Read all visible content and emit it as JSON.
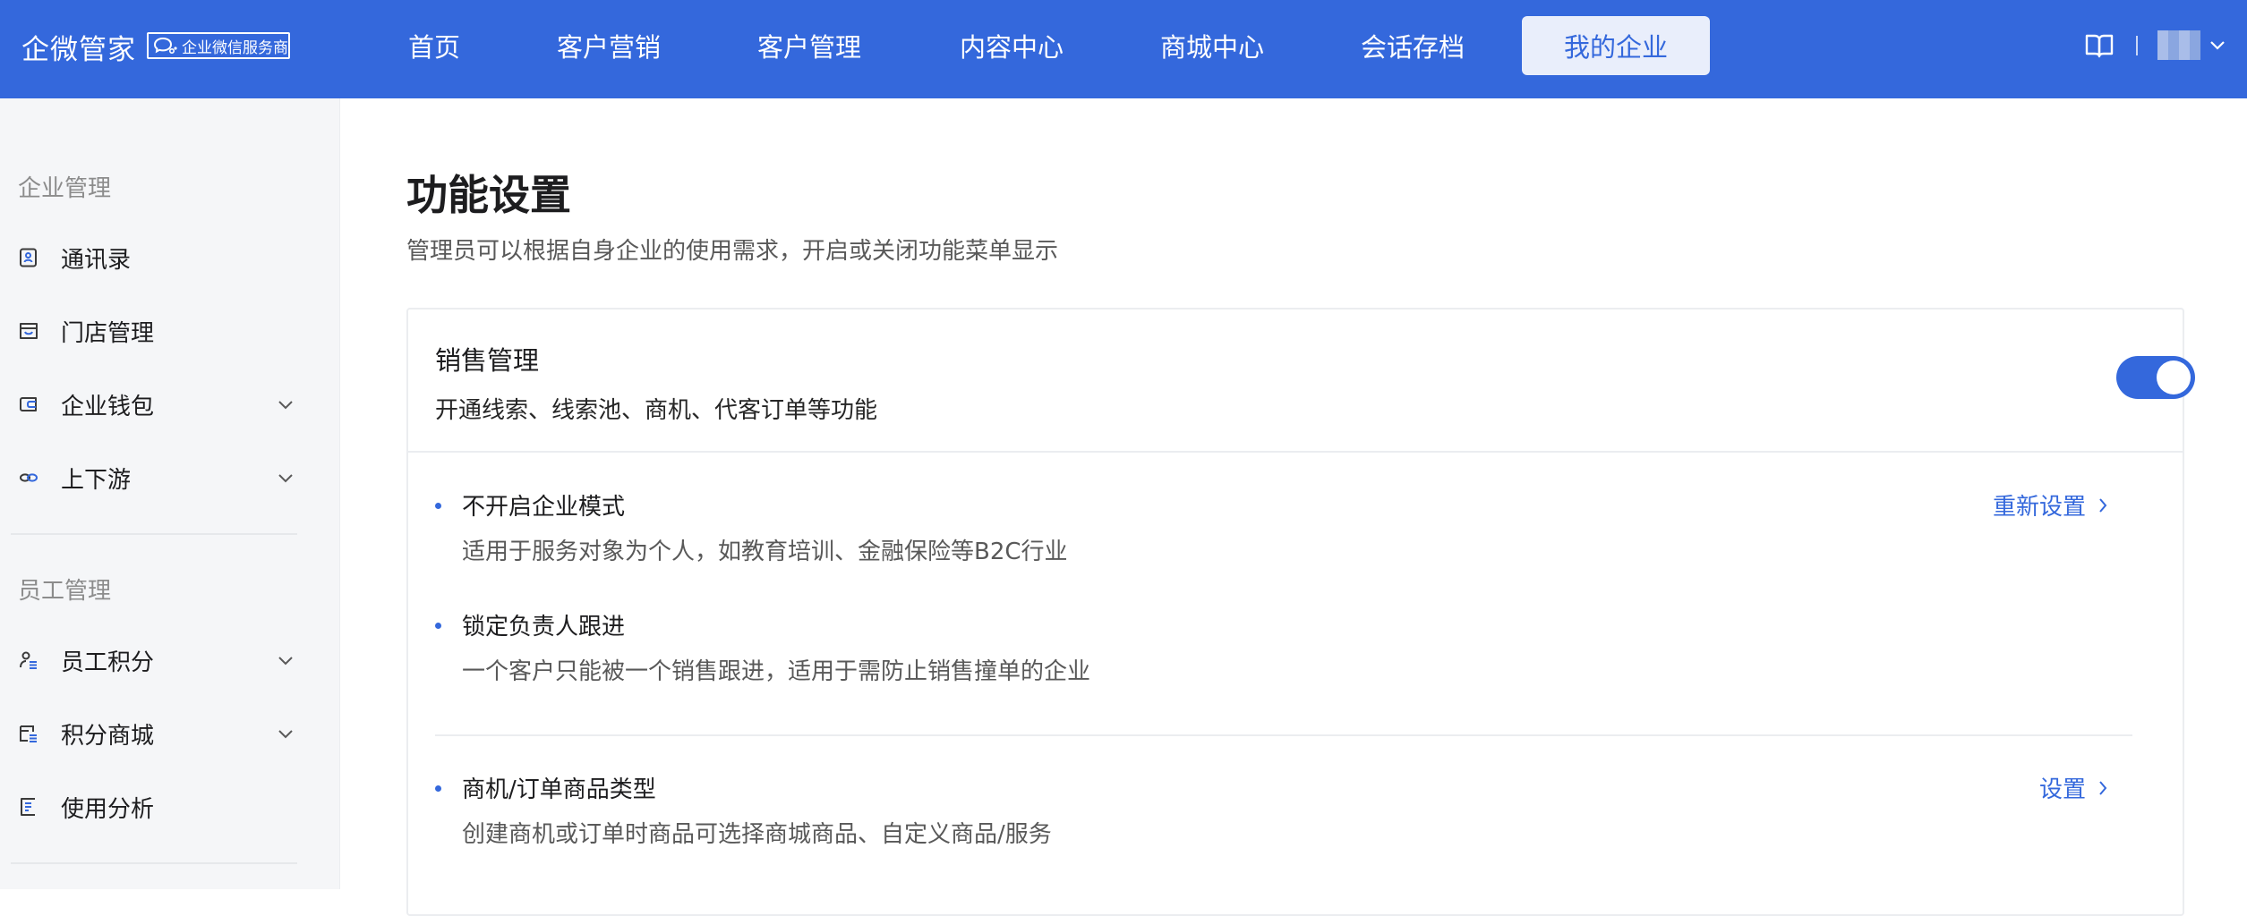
{
  "header": {
    "brand": "企微管家",
    "badge": "企业微信服务商",
    "nav": [
      {
        "label": "首页"
      },
      {
        "label": "客户营销"
      },
      {
        "label": "客户管理"
      },
      {
        "label": "内容中心"
      },
      {
        "label": "商城中心"
      },
      {
        "label": "会话存档"
      },
      {
        "label": "我的企业",
        "active": true
      }
    ],
    "icons": [
      "book-icon",
      "avatar",
      "chevron-down-icon"
    ]
  },
  "sidebar": {
    "sections": [
      {
        "title": "企业管理",
        "items": [
          {
            "label": "通讯录",
            "icon": "contacts-icon"
          },
          {
            "label": "门店管理",
            "icon": "store-icon"
          },
          {
            "label": "企业钱包",
            "icon": "wallet-icon",
            "expandable": true
          },
          {
            "label": "上下游",
            "icon": "link-icon",
            "expandable": true
          }
        ]
      },
      {
        "title": "员工管理",
        "items": [
          {
            "label": "员工积分",
            "icon": "user-points-icon",
            "expandable": true
          },
          {
            "label": "积分商城",
            "icon": "points-mall-icon",
            "expandable": true
          },
          {
            "label": "使用分析",
            "icon": "analysis-icon"
          }
        ]
      }
    ]
  },
  "main": {
    "title": "功能设置",
    "desc": "管理员可以根据自身企业的使用需求，开启或关闭功能菜单显示",
    "card": {
      "title": "销售管理",
      "desc": "开通线索、线索池、商机、代客订单等功能",
      "enabled": true,
      "options": [
        {
          "title": "不开启企业模式",
          "desc": "适用于服务对象为个人，如教育培训、金融保险等B2C行业",
          "link": "重新设置"
        },
        {
          "title": "锁定负责人跟进",
          "desc": "一个客户只能被一个销售跟进，适用于需防止销售撞单的企业"
        },
        {
          "title": "商机/订单商品类型",
          "desc": "创建商机或订单时商品可选择商城商品、自定义商品/服务",
          "link": "设置"
        }
      ]
    }
  },
  "colors": {
    "primary": "#3468dc",
    "sidebar_bg": "#f5f6f8",
    "active_nav_bg": "#e9eefb"
  }
}
